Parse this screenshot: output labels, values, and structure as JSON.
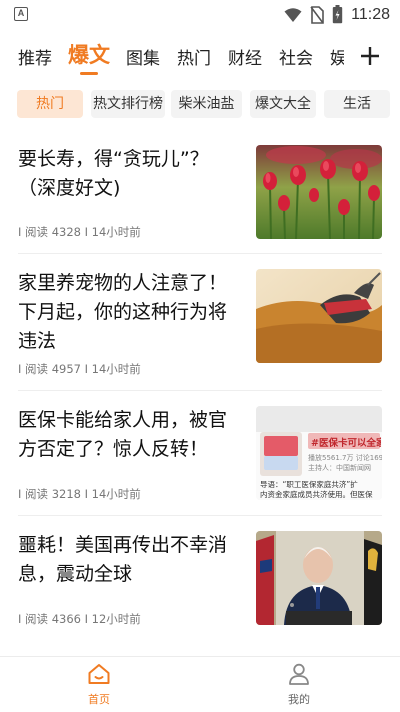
{
  "status_bar": {
    "time": "11:28",
    "app_icon_letter": "A"
  },
  "tabs": [
    {
      "label": "推荐",
      "active": false
    },
    {
      "label": "爆文",
      "active": true
    },
    {
      "label": "图集",
      "active": false
    },
    {
      "label": "热门",
      "active": false
    },
    {
      "label": "财经",
      "active": false
    },
    {
      "label": "社会",
      "active": false
    },
    {
      "label": "娱",
      "active": false
    }
  ],
  "chips": [
    {
      "label": "热门",
      "active": true
    },
    {
      "label": "热文排行榜",
      "active": false
    },
    {
      "label": "柴米油盐",
      "active": false
    },
    {
      "label": "爆文大全",
      "active": false
    },
    {
      "label": "生活",
      "active": false
    }
  ],
  "articles": [
    {
      "title": "要长寿，得“贪玩儿”？（深度好文)",
      "meta": "I 阅读 4328 I 14小时前",
      "thumb": "red-tulips-photo"
    },
    {
      "title": "家里养宠物的人注意了！下月起，你的这种行为将违法",
      "meta": "I 阅读 4957 I 14小时前",
      "thumb": "dog-with-harness-photo"
    },
    {
      "title": "医保卡能给家人用，被官方否定了？惊人反转！",
      "meta": "I 阅读 3218 I 14小时前",
      "thumb": "news-video-screenshot"
    },
    {
      "title": "噩耗！美国再传出不幸消息，震动全球",
      "meta": "I 阅读 4366 I 12小时前",
      "thumb": "speaker-at-podium-photo"
    }
  ],
  "thumb3_text": {
    "badge": "#医保卡可以全家",
    "reads": "播放5561.7万",
    "discuss": "讨论169",
    "host": "主持人：中国新闻网",
    "guide": "导语：“职工医保家庭共济”扩",
    "guide2": "内资金家庭成员共济使用。但医保"
  },
  "bottom_nav": [
    {
      "label": "首页",
      "active": true,
      "icon": "home-icon"
    },
    {
      "label": "我的",
      "active": false,
      "icon": "user-icon"
    }
  ],
  "colors": {
    "accent": "#f07b22",
    "accent_light": "#fde6d4",
    "text": "#222222",
    "meta": "#777777"
  }
}
